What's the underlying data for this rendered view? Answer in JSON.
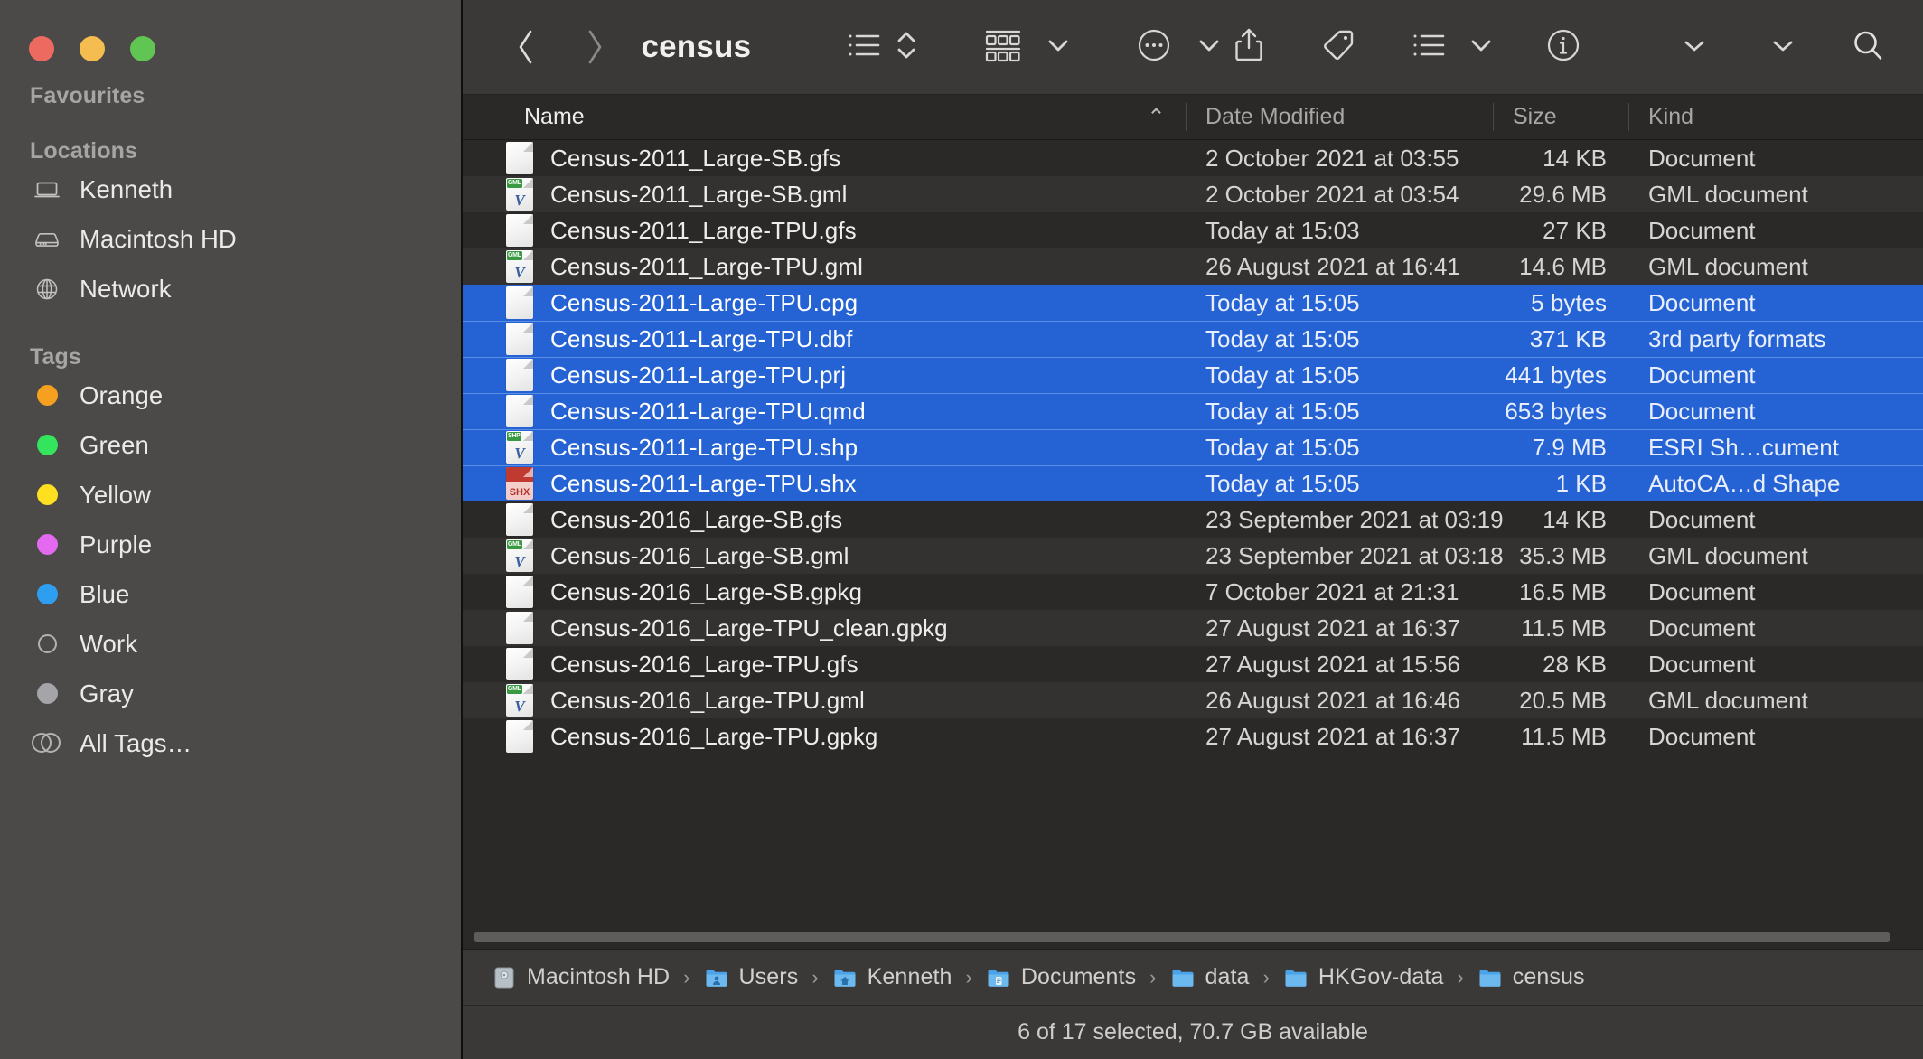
{
  "window": {
    "traffic_lights": [
      "close",
      "minimize",
      "zoom"
    ],
    "colors": {
      "close": "#ec6a5f",
      "minimize": "#f5bd4f",
      "zoom": "#61c554",
      "selection_blue": "#2563d4",
      "sidebar_bg": "#4b4a48",
      "content_bg": "#2b2927",
      "toolbar_bg": "#3a3937"
    }
  },
  "sidebar": {
    "sections": [
      {
        "title": "Favourites",
        "items": []
      },
      {
        "title": "Locations",
        "items": [
          {
            "label": "Kenneth",
            "icon": "laptop-icon"
          },
          {
            "label": "Macintosh HD",
            "icon": "harddisk-icon"
          },
          {
            "label": "Network",
            "icon": "globe-icon"
          }
        ]
      },
      {
        "title": "Tags",
        "items": [
          {
            "label": "Orange",
            "icon": "tag-dot-icon",
            "color": "#f5a01e"
          },
          {
            "label": "Green",
            "icon": "tag-dot-icon",
            "color": "#34e45d"
          },
          {
            "label": "Yellow",
            "icon": "tag-dot-icon",
            "color": "#ffe020"
          },
          {
            "label": "Purple",
            "icon": "tag-dot-icon",
            "color": "#e269f0"
          },
          {
            "label": "Blue",
            "icon": "tag-dot-icon",
            "color": "#2e9ff0"
          },
          {
            "label": "Work",
            "icon": "tag-dot-hollow-icon",
            "color": "none"
          },
          {
            "label": "Gray",
            "icon": "tag-dot-icon",
            "color": "#a5a5a9"
          },
          {
            "label": "All Tags…",
            "icon": "all-tags-icon",
            "color": "none"
          }
        ]
      }
    ]
  },
  "toolbar": {
    "back_label": "Back",
    "forward_label": "Forward",
    "title": "census",
    "buttons": [
      {
        "name": "list-view-icon",
        "label": "List View"
      },
      {
        "name": "sort-chevrons-icon",
        "label": "Sort"
      },
      {
        "name": "group-view-icon",
        "label": "Group By"
      },
      {
        "name": "group-chevron-icon",
        "label": "Group Options"
      },
      {
        "name": "more-actions-icon",
        "label": "More"
      },
      {
        "name": "more-chevron-icon",
        "label": "More Options"
      },
      {
        "name": "share-icon",
        "label": "Share"
      },
      {
        "name": "tag-icon",
        "label": "Tags"
      },
      {
        "name": "action-list-icon",
        "label": "Action"
      },
      {
        "name": "action-chevron-icon",
        "label": "Action Options"
      },
      {
        "name": "info-icon",
        "label": "Get Info"
      },
      {
        "name": "overflow-chevron-1-icon",
        "label": "More Toolbar Items"
      },
      {
        "name": "overflow-chevron-2-icon",
        "label": "More Toolbar Items"
      },
      {
        "name": "search-icon",
        "label": "Search"
      }
    ]
  },
  "columns": [
    {
      "key": "name",
      "label": "Name",
      "sorted": true,
      "sort_direction": "asc",
      "sort_caret": "⌃"
    },
    {
      "key": "date",
      "label": "Date Modified",
      "sorted": false
    },
    {
      "key": "size",
      "label": "Size",
      "sorted": false
    },
    {
      "key": "kind",
      "label": "Kind",
      "sorted": false
    }
  ],
  "files": [
    {
      "name": "Census-2011_Large-SB.gfs",
      "date": "2 October 2021 at 03:55",
      "size": "14 KB",
      "kind": "Document",
      "icon": "document-icon",
      "selected": false
    },
    {
      "name": "Census-2011_Large-SB.gml",
      "date": "2 October 2021 at 03:54",
      "size": "29.6 MB",
      "kind": "GML document",
      "icon": "gml-icon",
      "selected": false
    },
    {
      "name": "Census-2011_Large-TPU.gfs",
      "date": "Today at 15:03",
      "size": "27 KB",
      "kind": "Document",
      "icon": "document-icon",
      "selected": false
    },
    {
      "name": "Census-2011_Large-TPU.gml",
      "date": "26 August 2021 at 16:41",
      "size": "14.6 MB",
      "kind": "GML document",
      "icon": "gml-icon",
      "selected": false
    },
    {
      "name": "Census-2011-Large-TPU.cpg",
      "date": "Today at 15:05",
      "size": "5 bytes",
      "kind": "Document",
      "icon": "document-icon",
      "selected": true
    },
    {
      "name": "Census-2011-Large-TPU.dbf",
      "date": "Today at 15:05",
      "size": "371 KB",
      "kind": "3rd party formats",
      "icon": "document-icon",
      "selected": true
    },
    {
      "name": "Census-2011-Large-TPU.prj",
      "date": "Today at 15:05",
      "size": "441 bytes",
      "kind": "Document",
      "icon": "document-icon",
      "selected": true
    },
    {
      "name": "Census-2011-Large-TPU.qmd",
      "date": "Today at 15:05",
      "size": "653 bytes",
      "kind": "Document",
      "icon": "document-icon",
      "selected": true
    },
    {
      "name": "Census-2011-Large-TPU.shp",
      "date": "Today at 15:05",
      "size": "7.9 MB",
      "kind": "ESRI Sh…cument",
      "icon": "shp-icon",
      "selected": true
    },
    {
      "name": "Census-2011-Large-TPU.shx",
      "date": "Today at 15:05",
      "size": "1 KB",
      "kind": "AutoCA…d Shape",
      "icon": "shx-icon",
      "selected": true
    },
    {
      "name": "Census-2016_Large-SB.gfs",
      "date": "23 September 2021 at 03:19",
      "size": "14 KB",
      "kind": "Document",
      "icon": "document-icon",
      "selected": false
    },
    {
      "name": "Census-2016_Large-SB.gml",
      "date": "23 September 2021 at 03:18",
      "size": "35.3 MB",
      "kind": "GML document",
      "icon": "gml-icon",
      "selected": false
    },
    {
      "name": "Census-2016_Large-SB.gpkg",
      "date": "7 October 2021 at 21:31",
      "size": "16.5 MB",
      "kind": "Document",
      "icon": "document-icon",
      "selected": false
    },
    {
      "name": "Census-2016_Large-TPU_clean.gpkg",
      "date": "27 August 2021 at 16:37",
      "size": "11.5 MB",
      "kind": "Document",
      "icon": "document-icon",
      "selected": false
    },
    {
      "name": "Census-2016_Large-TPU.gfs",
      "date": "27 August 2021 at 15:56",
      "size": "28 KB",
      "kind": "Document",
      "icon": "document-icon",
      "selected": false
    },
    {
      "name": "Census-2016_Large-TPU.gml",
      "date": "26 August 2021 at 16:46",
      "size": "20.5 MB",
      "kind": "GML document",
      "icon": "gml-icon",
      "selected": false
    },
    {
      "name": "Census-2016_Large-TPU.gpkg",
      "date": "27 August 2021 at 16:37",
      "size": "11.5 MB",
      "kind": "Document",
      "icon": "document-icon",
      "selected": false
    }
  ],
  "pathbar": {
    "separator": "›",
    "crumbs": [
      {
        "label": "Macintosh HD",
        "icon": "harddisk-mini-icon"
      },
      {
        "label": "Users",
        "icon": "users-folder-icon"
      },
      {
        "label": "Kenneth",
        "icon": "home-folder-icon"
      },
      {
        "label": "Documents",
        "icon": "documents-folder-icon"
      },
      {
        "label": "data",
        "icon": "folder-icon"
      },
      {
        "label": "HKGov-data",
        "icon": "folder-icon"
      },
      {
        "label": "census",
        "icon": "folder-icon"
      }
    ]
  },
  "statusbar": {
    "text": "6 of 17 selected, 70.7 GB available"
  }
}
